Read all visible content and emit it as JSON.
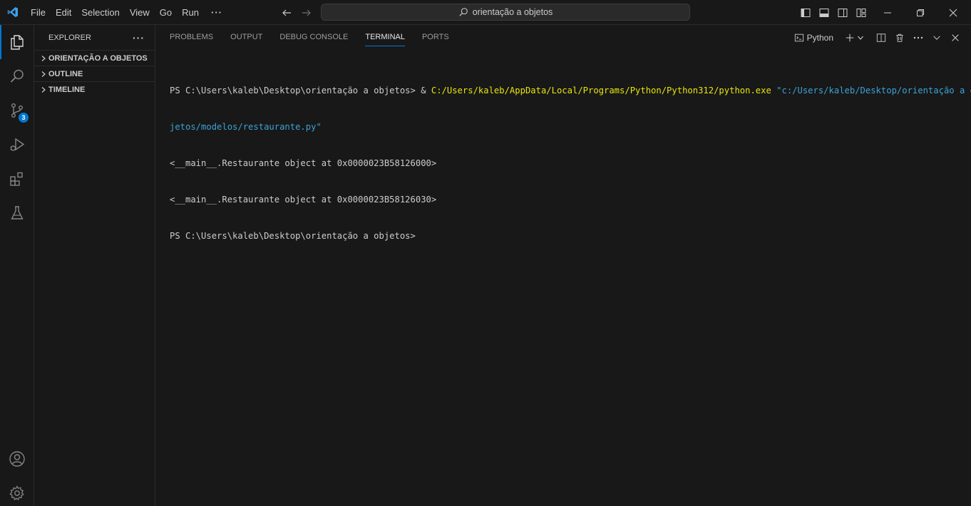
{
  "menu": {
    "items": [
      "File",
      "Edit",
      "Selection",
      "View",
      "Go",
      "Run"
    ],
    "more": "···"
  },
  "command_center": {
    "text": "orientação a objetos"
  },
  "activity_bar": {
    "source_control_badge": "3",
    "accent_color": "#0078d4"
  },
  "sidebar": {
    "title": "EXPLORER",
    "more": "···",
    "sections": [
      "ORIENTAÇÃO A OBJETOS",
      "OUTLINE",
      "TIMELINE"
    ]
  },
  "panel": {
    "tabs": [
      "PROBLEMS",
      "OUTPUT",
      "DEBUG CONSOLE",
      "TERMINAL",
      "PORTS"
    ],
    "active_tab": "TERMINAL",
    "terminal_name": "Python"
  },
  "terminal": {
    "line1_prompt": "PS C:\\Users\\kaleb\\Desktop\\orientação a objetos> & ",
    "line1_exe": "C:/Users/kaleb/AppData/Local/Programs/Python/Python312/python.exe",
    "line1_arg_start": " \"c:/Users/kaleb/Desktop/orientação a obi",
    "line2_arg_end": "jetos/modelos/restaurante.py\"",
    "line3": "<__main__.Restaurante object at 0x0000023B58126000>",
    "line4": "<__main__.Restaurante object at 0x0000023B58126030>",
    "line5": "PS C:\\Users\\kaleb\\Desktop\\orientação a objetos>"
  }
}
